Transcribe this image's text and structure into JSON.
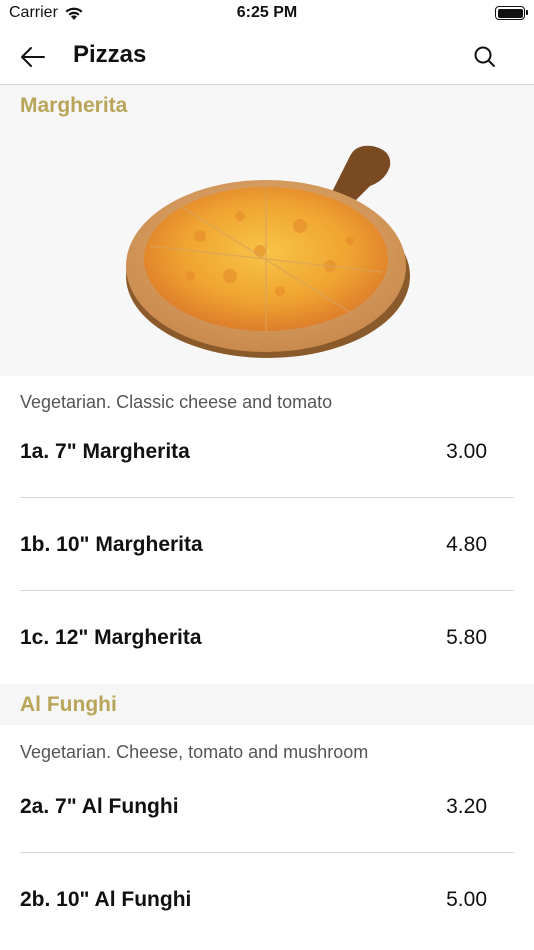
{
  "status_bar": {
    "carrier": "Carrier",
    "time": "6:25 PM"
  },
  "nav": {
    "title": "Pizzas"
  },
  "sections": [
    {
      "title": "Margherita",
      "description": "Vegetarian. Classic cheese and tomato",
      "items": [
        {
          "name": "1a. 7\" Margherita",
          "price": "3.00"
        },
        {
          "name": "1b. 10\" Margherita",
          "price": "4.80"
        },
        {
          "name": "1c. 12\" Margherita",
          "price": "5.80"
        }
      ]
    },
    {
      "title": "Al Funghi",
      "description": "Vegetarian. Cheese, tomato and mushroom",
      "items": [
        {
          "name": "2a. 7\" Al Funghi",
          "price": "3.20"
        },
        {
          "name": "2b. 10\" Al Funghi",
          "price": "5.00"
        }
      ]
    }
  ],
  "colors": {
    "section_title": "#b8a55a",
    "section_bg": "#f6f6f6",
    "divider": "#d6d6d6"
  }
}
